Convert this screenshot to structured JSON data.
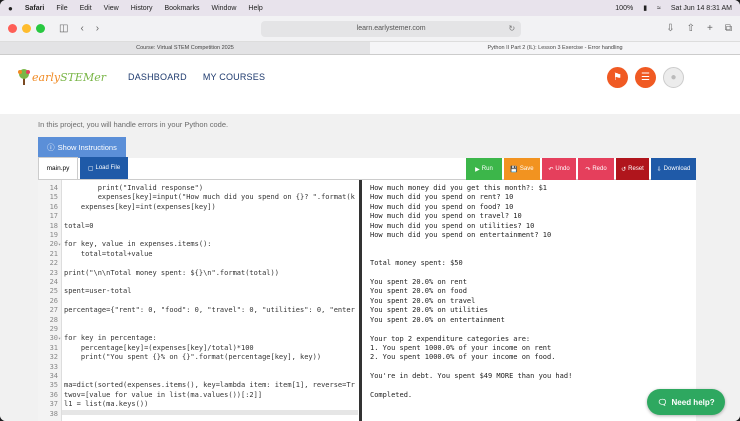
{
  "menubar": {
    "app": "Safari",
    "items": [
      "File",
      "Edit",
      "View",
      "History",
      "Bookmarks",
      "Window",
      "Help"
    ],
    "battery": "100%",
    "clock": "Sat Jun 14  8:31 AM"
  },
  "browser": {
    "url": "learn.earlystemer.com",
    "tabs": [
      "Course: Virtual STEM Competition 2025",
      "Python II Part 2 (IL): Lesson 3 Exercise - Error handling"
    ]
  },
  "site": {
    "logo_a": "early",
    "logo_b": "STEMer",
    "nav": [
      "DASHBOARD",
      "MY COURSES"
    ],
    "colors": {
      "accent": "#f05a23",
      "nav": "#1e3a6e"
    }
  },
  "lesson": {
    "intro": "In this project, you will handle errors in your Python code.",
    "show_instructions": "Show Instructions"
  },
  "ide": {
    "file_tab": "main.py",
    "load_file": "Load File",
    "actions": [
      {
        "label": "Run",
        "color": "#3cb64a"
      },
      {
        "label": "Save",
        "color": "#f29320"
      },
      {
        "label": "Undo",
        "color": "#e53f5c"
      },
      {
        "label": "Redo",
        "color": "#e53f5c"
      },
      {
        "label": "Reset",
        "color": "#b0151c"
      },
      {
        "label": "Download",
        "color": "#1f5aa8"
      }
    ],
    "code_lines": [
      {
        "n": "14",
        "fold": "",
        "code": "        print(\"Invalid response\")"
      },
      {
        "n": "15",
        "fold": "",
        "code": "        expenses[key]=input(\"How much did you spend on {}? \".format(k"
      },
      {
        "n": "16",
        "fold": "",
        "code": "    expenses[key]=int(expenses[key])"
      },
      {
        "n": "17",
        "fold": "",
        "code": ""
      },
      {
        "n": "18",
        "fold": "",
        "code": "total=0"
      },
      {
        "n": "19",
        "fold": "",
        "code": ""
      },
      {
        "n": "20",
        "fold": "▾",
        "code": "for key, value in expenses.items():"
      },
      {
        "n": "21",
        "fold": "",
        "code": "    total=total+value"
      },
      {
        "n": "22",
        "fold": "",
        "code": ""
      },
      {
        "n": "23",
        "fold": "",
        "code": "print(\"\\n\\nTotal money spent: ${}\\n\".format(total))"
      },
      {
        "n": "24",
        "fold": "",
        "code": ""
      },
      {
        "n": "25",
        "fold": "",
        "code": "spent=user-total"
      },
      {
        "n": "26",
        "fold": "",
        "code": ""
      },
      {
        "n": "27",
        "fold": "",
        "code": "percentage={\"rent\": 0, \"food\": 0, \"travel\": 0, \"utilities\": 0, \"enter"
      },
      {
        "n": "28",
        "fold": "",
        "code": ""
      },
      {
        "n": "29",
        "fold": "",
        "code": ""
      },
      {
        "n": "30",
        "fold": "▾",
        "code": "for key in percentage:"
      },
      {
        "n": "31",
        "fold": "",
        "code": "    percentage[key]=(expenses[key]/total)*100"
      },
      {
        "n": "32",
        "fold": "",
        "code": "    print(\"You spent {}% on {}\".format(percentage[key], key))"
      },
      {
        "n": "33",
        "fold": "",
        "code": ""
      },
      {
        "n": "34",
        "fold": "",
        "code": ""
      },
      {
        "n": "35",
        "fold": "",
        "code": "ma=dict(sorted(expenses.items(), key=lambda item: item[1], reverse=Tr"
      },
      {
        "n": "36",
        "fold": "",
        "code": "twov=[value for value in list(ma.values())[:2]]"
      },
      {
        "n": "37",
        "fold": "",
        "code": "l1 = list(ma.keys())"
      },
      {
        "n": "38",
        "fold": "",
        "code": ""
      }
    ],
    "output": "How much money did you get this month?: $1\nHow much did you spend on rent? 10\nHow much did you spend on food? 10\nHow much did you spend on travel? 10\nHow much did you spend on utilities? 10\nHow much did you spend on entertainment? 10\n\n\nTotal money spent: $50\n\nYou spent 20.0% on rent\nYou spent 20.0% on food\nYou spent 20.0% on travel\nYou spent 20.0% on utilities\nYou spent 20.0% on entertainment\n\nYour top 2 expenditure categories are:\n1. You spent 1000.0% of your income on rent\n2. You spent 1000.0% of your income on food.\n\nYou're in debt. You spent $49 MORE than you had!\n\nCompleted."
  },
  "help": "Need help?"
}
